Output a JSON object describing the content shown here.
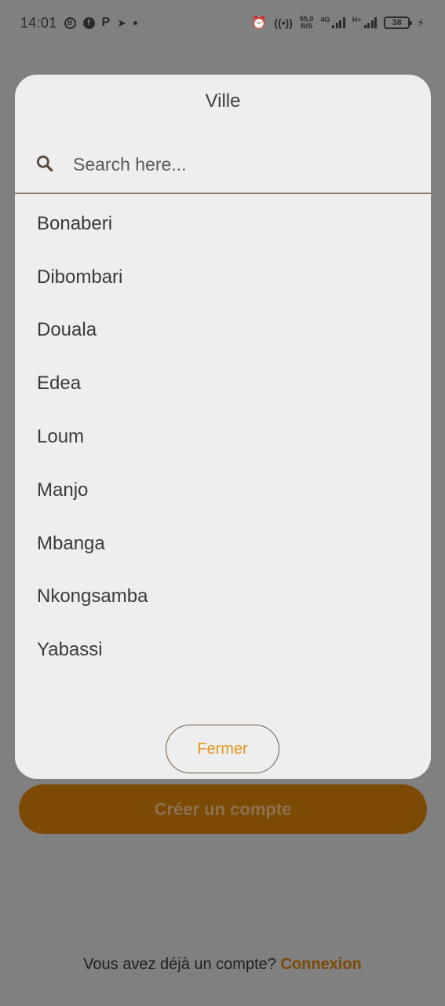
{
  "status_bar": {
    "time": "14:01",
    "speed_value": "55,0",
    "speed_unit": "B/S",
    "net_1": "4G",
    "net_2": "H+",
    "battery": "38"
  },
  "modal": {
    "title": "Ville",
    "search_placeholder": "Search here...",
    "cities": [
      "Bonaberi",
      "Dibombari",
      "Douala",
      "Edea",
      "Loum",
      "Manjo",
      "Mbanga",
      "Nkongsamba",
      "Yabassi"
    ],
    "close_label": "Fermer"
  },
  "background": {
    "create_account_label": "Créer un compte",
    "login_prompt": "Vous avez déjà un compte?",
    "login_link": "Connexion"
  },
  "colors": {
    "overlay": "#808080",
    "modal_bg": "#eeeeee",
    "accent": "#e0961e",
    "primary_dimmed": "#7c4a05"
  }
}
